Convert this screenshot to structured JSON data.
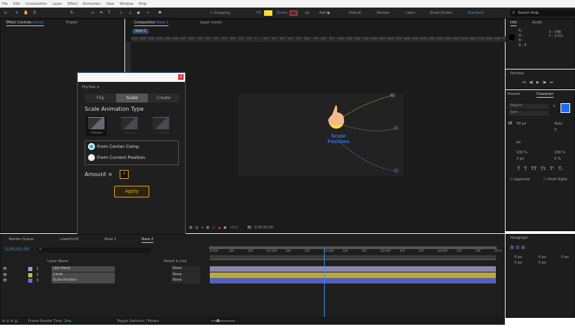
{
  "menu": [
    "File",
    "Edit",
    "Composition",
    "Layer",
    "Effect",
    "Animation",
    "View",
    "Window",
    "Help"
  ],
  "toolbar": {
    "snapping": "Snapping",
    "fill": "Fill",
    "stroke": "Stroke",
    "px": "px",
    "add": "Add",
    "workspaces": [
      "Default",
      "Review",
      "Learn",
      "Small Screen",
      "Standard"
    ],
    "search": "Search Help",
    "fill_color": "#ffe033"
  },
  "left_panel": {
    "tabs": [
      "Effect Controls",
      "(none)",
      "Project"
    ]
  },
  "comp_panel": {
    "tab": "Composition",
    "comp": "Base 2",
    "layer_tab": "Layer (none)",
    "breadcrumb": "Base 2",
    "ruler": [
      "1500",
      "1400",
      "1300",
      "1200",
      "1100",
      "1000",
      "900",
      "800",
      "700",
      "600",
      "500",
      "400",
      "300",
      "200",
      "100",
      "0",
      "100",
      "200",
      "300",
      "400",
      "500",
      "600",
      "700",
      "800",
      "900",
      "1000",
      "1100",
      "1200",
      "1300",
      "1400",
      "1500",
      "1600",
      "1700",
      "1800",
      "1900",
      "2000",
      "2100",
      "2200",
      "2300",
      "2400",
      "2500",
      "2600",
      "2700",
      "2800",
      "2900",
      "3000"
    ],
    "canvas_text": [
      "Scale",
      "Position"
    ],
    "zoom_value": "+0.0",
    "timecode": "0;00;02;00"
  },
  "plugin": {
    "title": "Flip-Test",
    "tabs": [
      "Flip",
      "Scale",
      "Create"
    ],
    "active_tab": "Scale",
    "heading": "Scale Animation Type",
    "types": [
      "X Position",
      "Y Position",
      "X & Y Position"
    ],
    "radios": [
      "From Center Comp",
      "From Current Position"
    ],
    "amount_label": "Amount ×",
    "amount_value": "0",
    "apply": "Apply",
    "accent": "#e6a81e"
  },
  "info": {
    "tabs": [
      "Info",
      "Audio"
    ],
    "r": "R :",
    "g": "G :",
    "b": "B :",
    "a": "A : 0",
    "x": "X : 546",
    "y": "Y : 1732"
  },
  "preview": {
    "title": "Preview"
  },
  "character": {
    "tabs": [
      "Presets",
      "Character"
    ],
    "font": "Poppins",
    "style": "Bold",
    "size": "90 px",
    "leading": "Auto",
    "tracking": "0",
    "stroke": "px",
    "vscale": "100 %",
    "hscale": "100 %",
    "baseline": "0 px",
    "tsume": "0 %",
    "styles": [
      "T",
      "T",
      "TT",
      "Tт",
      "T¹",
      "T₁"
    ],
    "ligatures": "Ligatures",
    "hindi": "Hindi Digits",
    "fill_color": "#1a6bff"
  },
  "paragraph": {
    "title": "Paragraph",
    "vals": [
      "0 px",
      "0 px",
      "0 px",
      "0 px",
      "0 px"
    ]
  },
  "timeline": {
    "tabs": [
      "Render Queue",
      "LowerthirD",
      "Base 1",
      "Base 2"
    ],
    "timecode": "0;00;02;00",
    "col_name": "Layer Name",
    "col_parent": "Parent & Link",
    "layers": [
      {
        "num": "1",
        "name": "Like Hand",
        "parent": "None",
        "color": "#a39ccc",
        "bar": "#8b86ad"
      },
      {
        "num": "2",
        "name": "Circle",
        "parent": "None",
        "color": "#c9b84a",
        "bar": "#b9a83a"
      },
      {
        "num": "3",
        "name": "Scale Position",
        "parent": "None",
        "color": "#6a73c6",
        "bar": "#5660b5"
      }
    ],
    "ticks": [
      "0:00f",
      "10f",
      "20f",
      "01:00f",
      "10f",
      "20f",
      "02:00f",
      "10f",
      "20f",
      "03:00f",
      "10f",
      "20f",
      "04:00f",
      "10f",
      "20f",
      "05:0"
    ],
    "playhead_fraction": 0.4
  },
  "status": {
    "render": "Frame Render Time:",
    "render_val": "2ms",
    "toggle": "Toggle Switches / Modes"
  }
}
